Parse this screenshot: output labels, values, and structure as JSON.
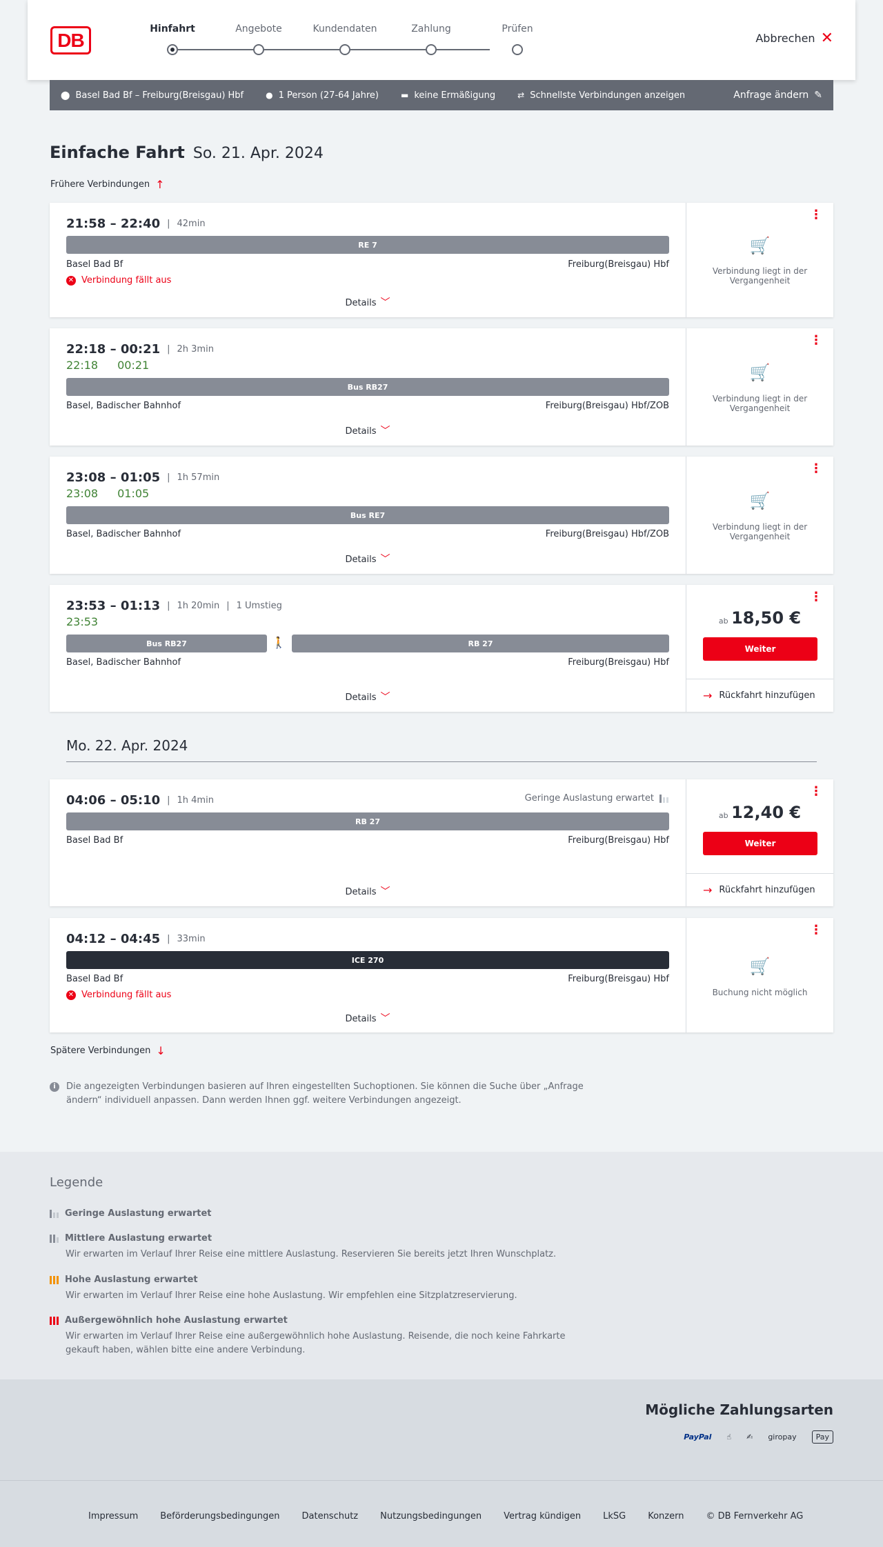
{
  "header": {
    "logo": "DB",
    "steps": [
      "Hinfahrt",
      "Angebote",
      "Kundendaten",
      "Zahlung",
      "Prüfen"
    ],
    "cancel_label": "Abbrechen"
  },
  "search": {
    "route": "Basel Bad Bf – Freiburg(Breisgau) Hbf",
    "persons": "1 Person (27-64 Jahre)",
    "discount": "keine Ermäßigung",
    "fastest": "Schnellste Verbindungen anzeigen",
    "change": "Anfrage ändern"
  },
  "main": {
    "title": "Einfache Fahrt",
    "date": "So. 21. Apr. 2024",
    "earlier": "Frühere Verbindungen",
    "later": "Spätere Verbindungen",
    "next_day": "Mo. 22. Apr. 2024",
    "details_label": "Details",
    "weiter_label": "Weiter",
    "return_label": "Rückfahrt hinzufügen",
    "ab": "ab",
    "past_label": "Verbindung liegt in der Vergangenheit",
    "cancelled_label": "Verbindung fällt aus",
    "no_booking": "Buchung nicht möglich"
  },
  "connections": [
    {
      "times": "21:58 – 22:40",
      "duration": "42min",
      "train": "RE 7",
      "from": "Basel Bad Bf",
      "to": "Freiburg(Breisgau) Hbf"
    },
    {
      "times": "22:18 – 00:21",
      "duration": "2h 3min",
      "rt_dep": "22:18",
      "rt_arr": "00:21",
      "train": "Bus RB27",
      "from": "Basel, Badischer Bahnhof",
      "to": "Freiburg(Breisgau) Hbf/ZOB"
    },
    {
      "times": "23:08 – 01:05",
      "duration": "1h 57min",
      "rt_dep": "23:08",
      "rt_arr": "01:05",
      "train": "Bus RE7",
      "from": "Basel, Badischer Bahnhof",
      "to": "Freiburg(Breisgau) Hbf/ZOB"
    },
    {
      "times": "23:53 – 01:13",
      "duration": "1h 20min",
      "transfers": "1 Umstieg",
      "rt_dep": "23:53",
      "train": "Bus RB27",
      "train2": "RB 27",
      "from": "Basel, Badischer Bahnhof",
      "to": "Freiburg(Breisgau) Hbf",
      "price": "18,50 €"
    },
    {
      "times": "04:06 – 05:10",
      "duration": "1h 4min",
      "occupancy": "Geringe Auslastung erwartet",
      "train": "RB 27",
      "from": "Basel Bad Bf",
      "to": "Freiburg(Breisgau) Hbf",
      "price": "12,40 €"
    },
    {
      "times": "04:12 – 04:45",
      "duration": "33min",
      "train": "ICE 270",
      "from": "Basel Bad Bf",
      "to": "Freiburg(Breisgau) Hbf"
    }
  ],
  "info": "Die angezeigten Verbindungen basieren auf Ihren eingestellten Suchoptionen. Sie können die Suche über „Anfrage ändern“ individuell anpassen. Dann werden Ihnen ggf. weitere Verbindungen angezeigt.",
  "legend": {
    "title": "Legende",
    "items": [
      {
        "title": "Geringe Auslastung erwartet",
        "desc": ""
      },
      {
        "title": "Mittlere Auslastung erwartet",
        "desc": "Wir erwarten im Verlauf Ihrer Reise eine mittlere Auslastung. Reservieren Sie bereits jetzt Ihren Wunschplatz."
      },
      {
        "title": "Hohe Auslastung erwartet",
        "desc": "Wir erwarten im Verlauf Ihrer Reise eine hohe Auslastung. Wir empfehlen eine Sitzplatzreservierung."
      },
      {
        "title": "Außergewöhnlich hohe Auslastung erwartet",
        "desc": "Wir erwarten im Verlauf Ihrer Reise eine außergewöhnlich hohe Auslastung. Reisende, die noch keine Fahrkarte gekauft haben, wählen bitte eine andere Verbindung."
      }
    ],
    "colors": [
      "#878c96",
      "#878c96",
      "#f39200",
      "#ec0016"
    ]
  },
  "payment": {
    "title": "Mögliche Zahlungsarten",
    "paypal": "PayPal",
    "giropay": "giropay",
    "applepay": "Pay"
  },
  "footer": [
    "Impressum",
    "Beförderungsbedingungen",
    "Datenschutz",
    "Nutzungsbedingungen",
    "Vertrag kündigen",
    "LkSG",
    "Konzern",
    "© DB Fernverkehr AG"
  ]
}
